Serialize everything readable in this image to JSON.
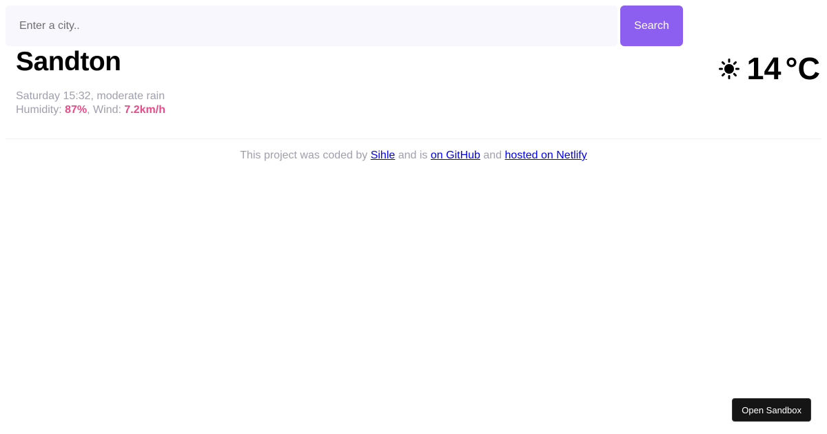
{
  "search": {
    "placeholder": "Enter a city..",
    "value": "",
    "button_label": "Search"
  },
  "weather": {
    "city": "Sandton",
    "datetime_description": "Saturday 15:32, moderate rain",
    "humidity_label": "Humidity: ",
    "humidity_value": "87%",
    "wind_label": ", Wind: ",
    "wind_value": "7.2km/h",
    "icon": "sun-icon",
    "temperature": "14",
    "unit": "°C"
  },
  "footer": {
    "text_1": "This project was coded by ",
    "link_author": "Sihle",
    "text_2": " and is ",
    "link_github": "on GitHub",
    "text_3": " and ",
    "link_netlify": "hosted on Netlify"
  },
  "sandbox": {
    "button_label": "Open Sandbox"
  },
  "colors": {
    "accent": "#8c5ff0",
    "highlight": "#ea4c88",
    "muted_text": "#9f9fad",
    "input_background": "#f8f7fd"
  }
}
